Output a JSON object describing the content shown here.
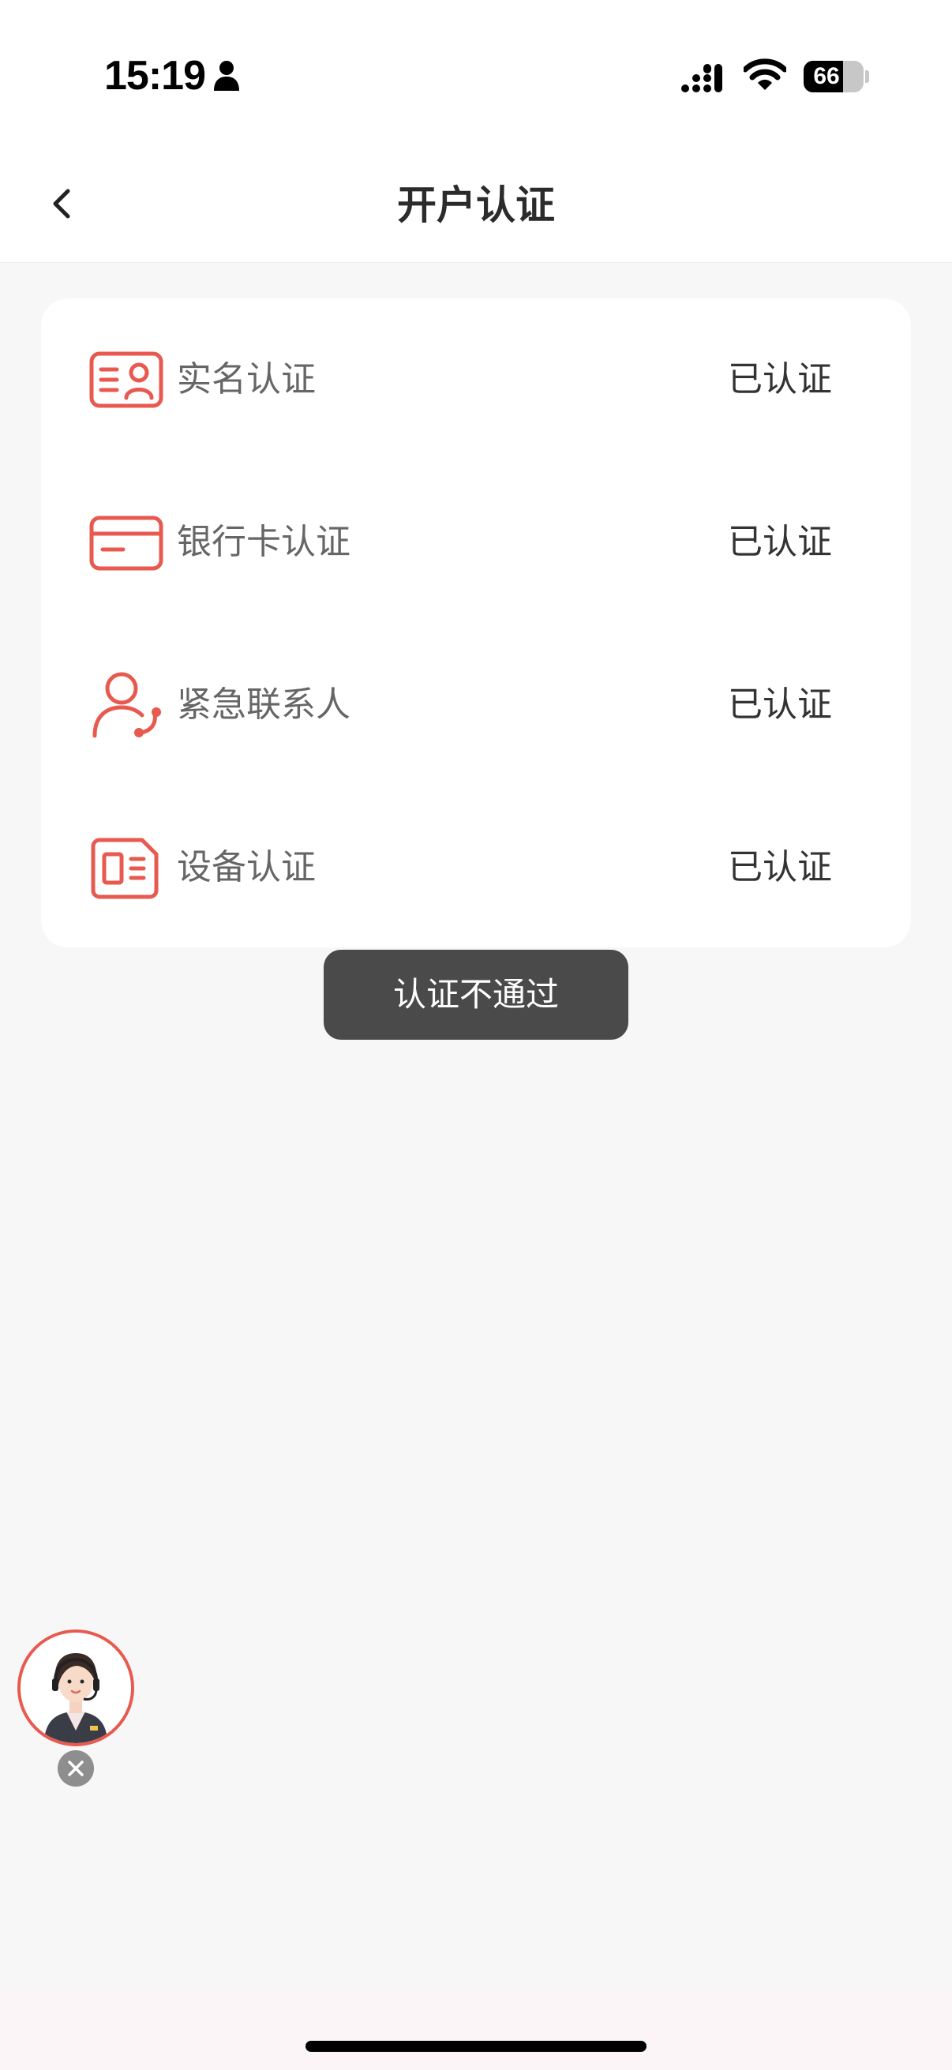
{
  "status_bar": {
    "time": "15:19",
    "battery": "66",
    "battery_level": 0.66
  },
  "header": {
    "title": "开户认证",
    "back_icon": "chevron-left-icon"
  },
  "verification_items": [
    {
      "icon": "id-card-icon",
      "label": "实名认证",
      "status": "已认证"
    },
    {
      "icon": "bank-card-icon",
      "label": "银行卡认证",
      "status": "已认证"
    },
    {
      "icon": "contact-phone-icon",
      "label": "紧急联系人",
      "status": "已认证"
    },
    {
      "icon": "device-icon",
      "label": "设备认证",
      "status": "已认证"
    }
  ],
  "toast": {
    "message": "认证不通过"
  },
  "floating_service": {
    "icon": "customer-service-avatar",
    "close_icon": "close-icon"
  },
  "colors": {
    "accent": "#e85a4f",
    "background": "#f7f7f7",
    "card": "#ffffff",
    "toast": "#4a4a4a"
  }
}
